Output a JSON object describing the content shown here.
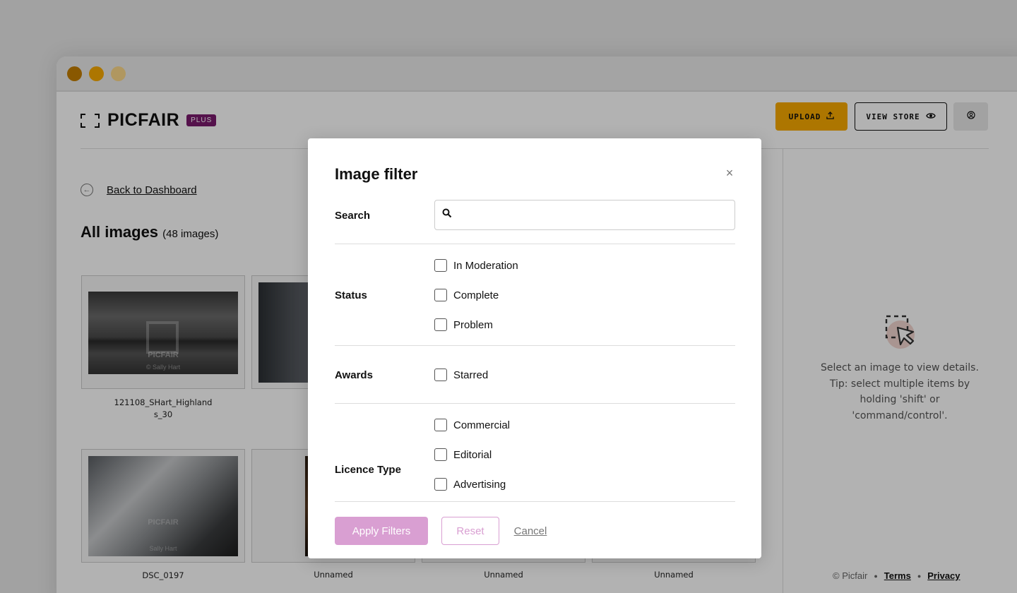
{
  "app": {
    "brand": "PICFAIR",
    "badge": "PLUS",
    "header": {
      "upload_label": "UPLOAD",
      "view_store_label": "VIEW STORE"
    },
    "back_link": "Back to Dashboard",
    "page_title": "All images",
    "image_count": "(48 images)",
    "thumbnails": [
      {
        "caption_line1": "121108_SHart_Highland",
        "caption_line2": "s_30",
        "watermark": "PICFAIR",
        "credit": "© Sally Hart"
      },
      {
        "caption_line1": "",
        "caption_line2": ""
      },
      {
        "caption_line1": "DSC_0197",
        "caption_line2": "",
        "watermark": "PICFAIR",
        "credit": "Sally Hart"
      },
      {
        "caption_line1": "Unnamed",
        "caption_line2": ""
      },
      {
        "caption_line1": "Unnamed",
        "caption_line2": ""
      },
      {
        "caption_line1": "Unnamed",
        "caption_line2": ""
      }
    ],
    "side_panel": {
      "line1": "Select an image to view details.",
      "line2": "Tip: select multiple items by",
      "line3": "holding 'shift' or",
      "line4": "'command/control'.",
      "copyright": "© Picfair",
      "terms": "Terms",
      "privacy": "Privacy"
    }
  },
  "modal": {
    "title": "Image filter",
    "search": {
      "label": "Search",
      "value": "",
      "placeholder": ""
    },
    "status": {
      "label": "Status",
      "options": [
        "In Moderation",
        "Complete",
        "Problem"
      ]
    },
    "awards": {
      "label": "Awards",
      "options": [
        "Starred"
      ]
    },
    "licence": {
      "label": "Licence Type",
      "options": [
        "Commercial",
        "Editorial",
        "Advertising"
      ]
    },
    "apply_label": "Apply Filters",
    "reset_label": "Reset",
    "cancel_label": "Cancel"
  },
  "colors": {
    "accent_yellow": "#f8aa00",
    "brand_purple": "#7a1a6e",
    "apply_pink": "#d99fd2"
  }
}
